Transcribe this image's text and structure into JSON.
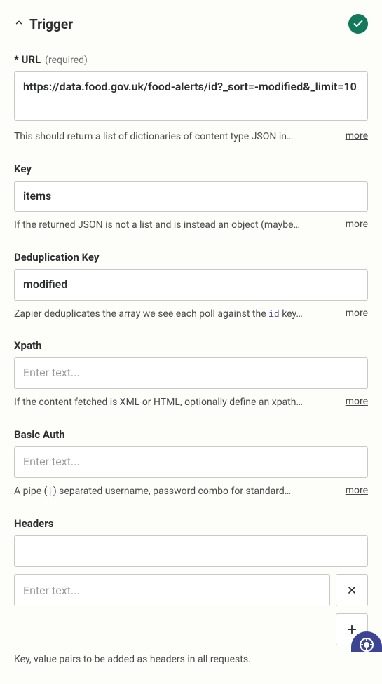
{
  "header": {
    "title": "Trigger"
  },
  "fields": {
    "url": {
      "label": "URL",
      "required_text": "(required)",
      "value": "https://data.food.gov.uk/food-alerts/id?_sort=-modified&_limit=10",
      "help": "This should return a list of dictionaries of content type JSON in…",
      "more": "more"
    },
    "key": {
      "label": "Key",
      "value": "items",
      "help": "If the returned JSON is not a list and is instead an object (maybe…",
      "more": "more"
    },
    "dedup": {
      "label": "Deduplication Key",
      "value": "modified",
      "help_prefix": "Zapier deduplicates the array we see each poll against the ",
      "help_code": "id",
      "help_suffix": " key…",
      "more": "more"
    },
    "xpath": {
      "label": "Xpath",
      "placeholder": "Enter text...",
      "help": "If the content fetched is XML or HTML, optionally define an xpath…",
      "more": "more"
    },
    "basic_auth": {
      "label": "Basic Auth",
      "placeholder": "Enter text...",
      "help_prefix": "A pipe (",
      "help_pipe": "|",
      "help_suffix": ") separated username, password combo for standard…",
      "more": "more"
    },
    "headers": {
      "label": "Headers",
      "value_placeholder": "Enter text...",
      "help": "Key, value pairs to be added as headers in all requests."
    }
  }
}
